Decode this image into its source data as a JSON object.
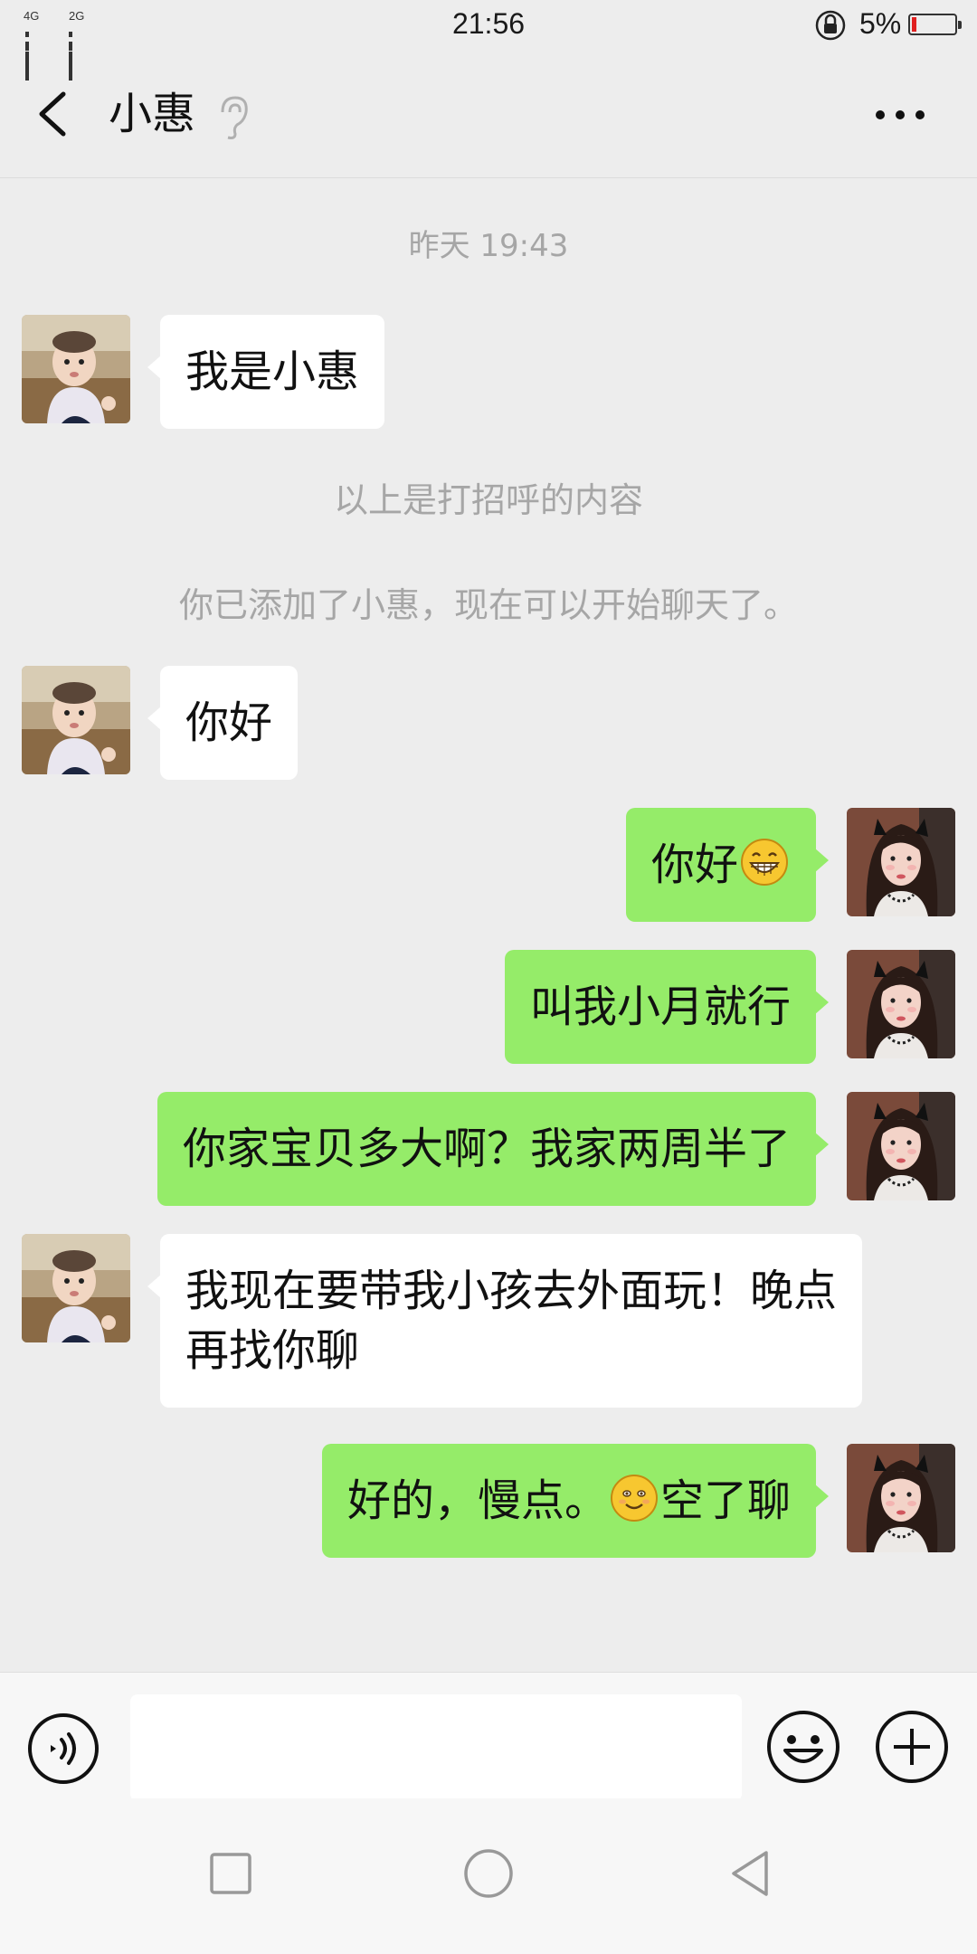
{
  "status_bar": {
    "sim1": "4G",
    "sim2": "2G",
    "time": "21:56",
    "battery_percent": "5%",
    "battery_level": 0.05
  },
  "header": {
    "title": "小惠"
  },
  "chat": {
    "timestamp": "昨天 19:43",
    "messages": [
      {
        "side": "in",
        "text": "我是小惠"
      },
      {
        "side": "system",
        "text": "以上是打招呼的内容"
      },
      {
        "side": "system",
        "text": "你已添加了小惠，现在可以开始聊天了。"
      },
      {
        "side": "in",
        "text": "你好"
      },
      {
        "side": "out",
        "text": "你好",
        "emoji": "grinning-face-emoji"
      },
      {
        "side": "out",
        "text": "叫我小月就行"
      },
      {
        "side": "out",
        "text": "你家宝贝多大啊？我家两周半了"
      },
      {
        "side": "in",
        "text": "我现在要带我小孩去外面玩！晚点再找你聊"
      },
      {
        "side": "out",
        "text_before": "好的，慢点。",
        "emoji": "smiling-face-emoji",
        "text_after": "空了聊"
      }
    ]
  },
  "input_bar": {
    "placeholder": ""
  },
  "icons": {
    "back": "back-arrow-icon",
    "ear": "ear-icon",
    "more": "more-dots-icon",
    "voice": "voice-icon",
    "emoji": "emoji-icon",
    "plus": "plus-icon",
    "nav_recent": "square-icon",
    "nav_home": "circle-icon",
    "nav_back": "triangle-icon"
  },
  "colors": {
    "outgoing_bubble": "#95ec69",
    "incoming_bubble": "#ffffff",
    "background": "#ededed"
  }
}
